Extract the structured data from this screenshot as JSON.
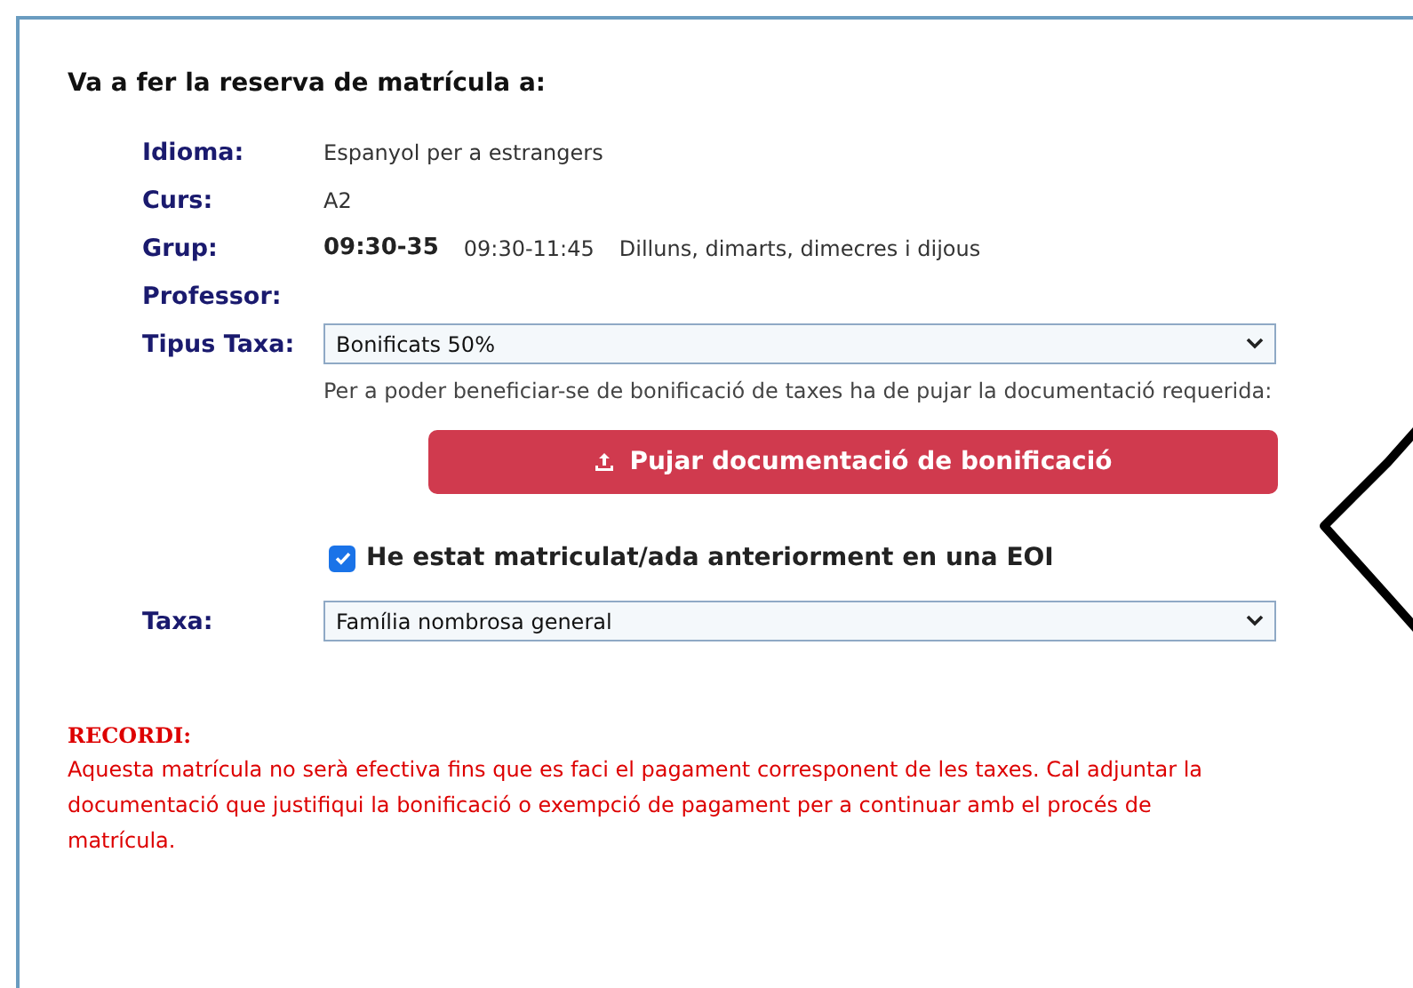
{
  "heading": "Va a fer la reserva de matrícula a:",
  "details": [
    {
      "label": "Idioma:",
      "values": [
        {
          "text": "Espanyol per a estrangers",
          "bold": false
        }
      ]
    },
    {
      "label": "Curs:",
      "values": [
        {
          "text": "A2",
          "bold": false
        }
      ]
    },
    {
      "label": "Grup:",
      "values": [
        {
          "text": "09:30-35",
          "bold": true
        },
        {
          "text": "09:30-11:45",
          "bold": false
        },
        {
          "text": "Dilluns, dimarts, dimecres i dijous",
          "bold": false
        }
      ]
    },
    {
      "label": "Professor:"
    }
  ],
  "fee_type": {
    "label": "Tipus Taxa:",
    "value": "Bonificats 50%"
  },
  "help_text": "Per a poder beneficiar-se de bonificació de taxes ha de pujar la documentació requerida:",
  "upload_button": "Pujar documentació de bonificació",
  "previous_enrolment": {
    "label": "He estat matriculat/ada anteriorment en una EOI",
    "checked": true
  },
  "fee": {
    "label": "Taxa:",
    "value": "Família nombrosa general"
  },
  "reminder": {
    "title": "RECORDI:",
    "text": "Aquesta matrícula no serà efectiva fins que es faci el pagament corresponent de les taxes. Cal adjuntar la documentació que justifiqui la bonificació o exempció de pagament per a continuar amb el procés de matrícula."
  }
}
